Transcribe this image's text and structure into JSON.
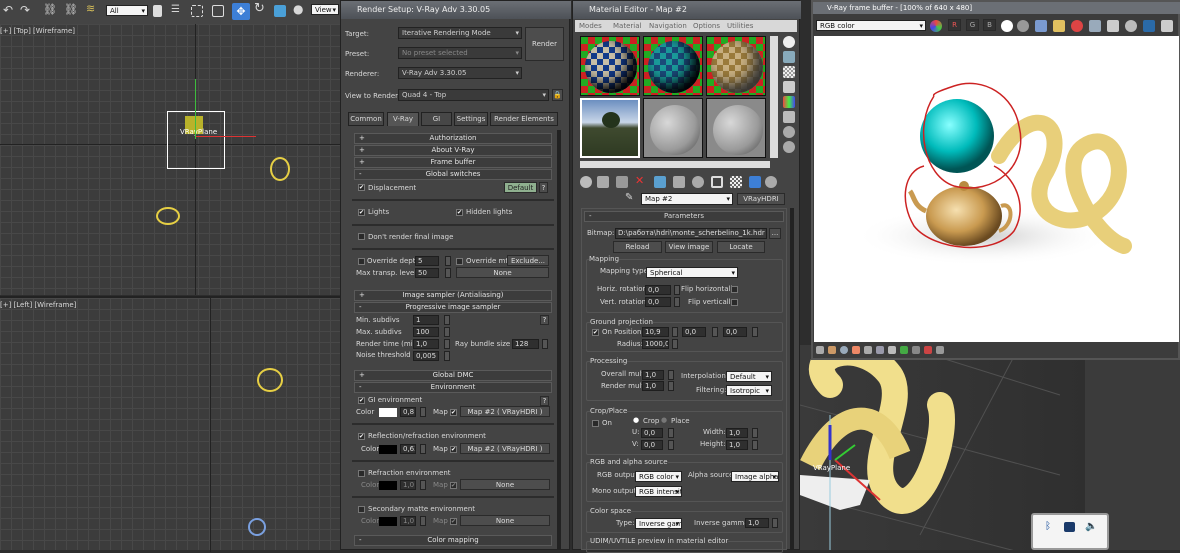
{
  "toolbar": {
    "selection_filter": "All",
    "ref_coord": "View",
    "icons": [
      "undo-icon",
      "redo-icon",
      "link-icon",
      "unlink-icon",
      "bind-space-warp-icon",
      "select-object-icon",
      "select-by-name-icon",
      "rect-selection-icon",
      "window-crossing-icon",
      "move-icon",
      "rotate-icon",
      "scale-icon",
      "pivot-icon"
    ]
  },
  "viewports": {
    "top_label": "[+] [Top] [Wireframe]",
    "left_label": "[+] [Left] [Wireframe]",
    "object_label": "VRayPlane"
  },
  "render_setup": {
    "title": "Render Setup: V-Ray Adv 3.30.05",
    "target_label": "Target:",
    "target": "Iterative Rendering Mode",
    "preset_label": "Preset:",
    "preset": "No preset selected",
    "renderer_label": "Renderer:",
    "renderer": "V-Ray Adv 3.30.05",
    "view_label": "View to Render:",
    "view": "Quad 4 - Top",
    "render_button": "Render",
    "tabs": [
      "Common",
      "V-Ray",
      "GI",
      "Settings",
      "Render Elements"
    ],
    "active_tab": "V-Ray",
    "rollouts": {
      "authorization": "Authorization",
      "about": "About V-Ray",
      "frame_buffer": "Frame buffer",
      "global_switches": "Global switches",
      "image_sampler": "Image sampler (Antialiasing)",
      "progressive": "Progressive image sampler",
      "global_dmc": "Global DMC",
      "environment": "Environment",
      "color_mapping": "Color mapping"
    },
    "global": {
      "displacement": "Displacement",
      "default_button": "Default",
      "help": "?",
      "lights": "Lights",
      "hidden_lights": "Hidden lights",
      "dont_render": "Don't render final image",
      "override_depth": "Override depth",
      "override_depth_value": "5",
      "override_mtl": "Override mtl",
      "exclude": "Exclude...",
      "max_transp": "Max transp. levels",
      "max_transp_value": "50",
      "none": "None"
    },
    "progressive": {
      "min_subdivs_label": "Min. subdivs",
      "min_subdivs": "1",
      "max_subdivs_label": "Max. subdivs",
      "max_subdivs": "100",
      "render_time_label": "Render time (min)",
      "render_time": "1,0",
      "ray_bundle_label": "Ray bundle size",
      "ray_bundle": "128",
      "noise_label": "Noise threshold",
      "noise": "0,005"
    },
    "environment": {
      "color_label": "Color",
      "map_label": "Map",
      "gi": {
        "label": "GI environment",
        "checked": true,
        "color": "#ffffff",
        "mult": "0,8",
        "map": "Map #2  ( VRayHDRI )"
      },
      "refl": {
        "label": "Reflection/refraction environment",
        "checked": true,
        "color": "#000000",
        "mult": "0,63",
        "map": "Map #2  ( VRayHDRI )"
      },
      "refr": {
        "label": "Refraction environment",
        "checked": false,
        "color": "#000000",
        "mult": "1,0",
        "map": "None"
      },
      "matte": {
        "label": "Secondary matte environment",
        "checked": false,
        "color": "#000000",
        "mult": "1,0",
        "map": "None"
      }
    }
  },
  "material_editor": {
    "title": "Material Editor - Map #2",
    "menu": [
      "Modes",
      "Material",
      "Navigation",
      "Options",
      "Utilities"
    ],
    "map_name": "Map #2",
    "map_type": "VRayHDRI",
    "params_title": "Parameters",
    "bitmap_label": "Bitmap:",
    "bitmap_path": "D:\\работа\\hdri\\monte_scherbelino_1k.hdr",
    "browse": "...",
    "reload": "Reload",
    "view_image": "View image",
    "locate": "Locate",
    "mapping": {
      "title": "Mapping",
      "type_label": "Mapping type:",
      "type": "Spherical",
      "horiz_label": "Horiz. rotation:",
      "horiz": "0,0",
      "flip_h": "Flip horizontally",
      "vert_label": "Vert. rotation:",
      "vert": "0,0",
      "flip_v": "Flip vertically"
    },
    "ground": {
      "title": "Ground projection",
      "on_label": "On Position:",
      "x": "10,9",
      "y": "0,0",
      "z": "0,0",
      "radius_label": "Radius:",
      "radius": "1000,0"
    },
    "processing": {
      "title": "Processing",
      "overall_label": "Overall mult:",
      "overall": "1,0",
      "render_label": "Render mult:",
      "render": "1,0",
      "interp_label": "Interpolation:",
      "interp": "Default",
      "filter_label": "Filtering:",
      "filter": "Isotropic"
    },
    "crop": {
      "title": "Crop/Place",
      "on": "On",
      "crop": "Crop",
      "place": "Place",
      "u_label": "U:",
      "u": "0,0",
      "v_label": "V:",
      "v": "0,0",
      "w_label": "Width:",
      "w": "1,0",
      "h_label": "Height:",
      "h": "1,0"
    },
    "rgb": {
      "title": "RGB and alpha source",
      "rgb_label": "RGB output:",
      "rgb": "RGB color",
      "alpha_label": "Alpha source:",
      "alpha": "Image alpha",
      "mono_label": "Mono output:",
      "mono": "RGB intensity"
    },
    "colorspace": {
      "title": "Color space",
      "type_label": "Type:",
      "type": "Inverse gamma",
      "gamma_label": "Inverse gamma:",
      "gamma": "1,0"
    },
    "udim": "UDIM/UVTILE preview in material editor"
  },
  "frame_buffer": {
    "title": "V-Ray frame buffer - [100% of 640 x 480]",
    "channel": "RGB color",
    "r": "R",
    "g": "G",
    "b": "B"
  },
  "tray": {
    "icons": [
      "bluetooth-icon",
      "network-icon",
      "speaker-icon"
    ]
  }
}
